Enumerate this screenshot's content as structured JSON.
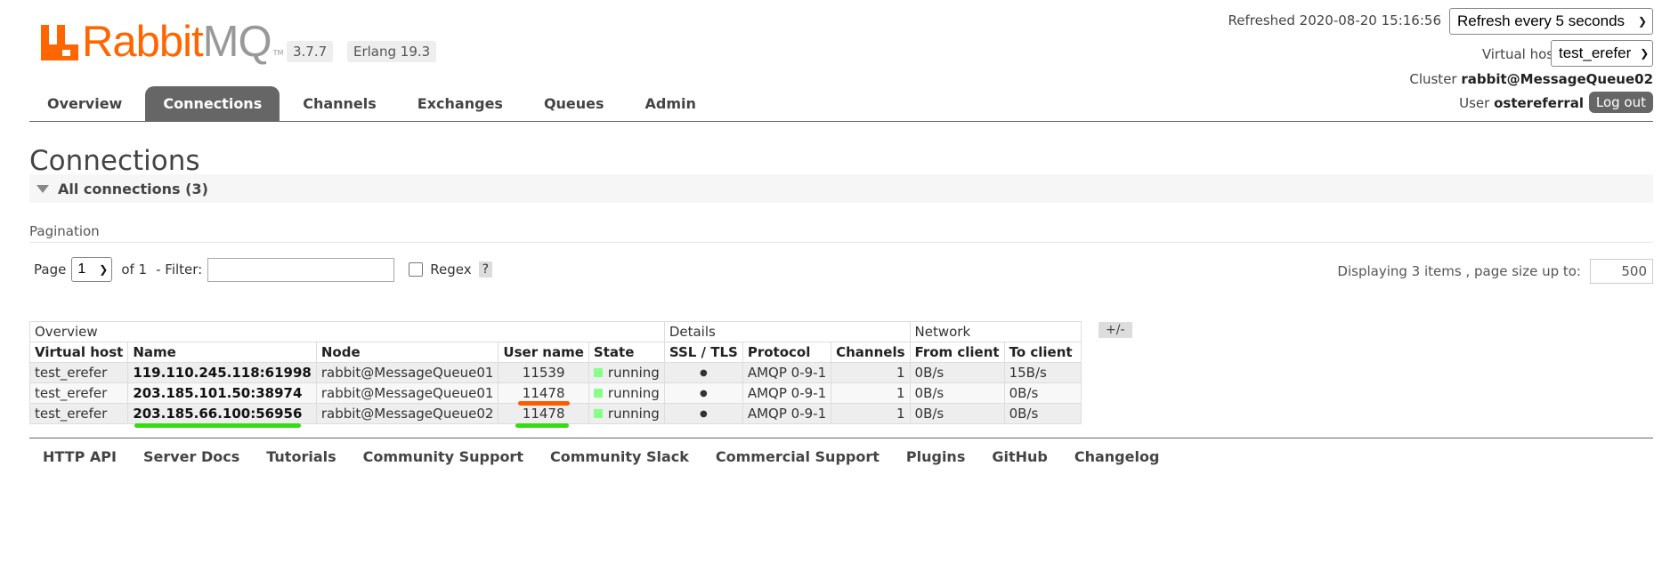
{
  "header": {
    "logo_text_rabbit": "Rabbit",
    "logo_text_mq": "MQ",
    "logo_tm": "TM",
    "version": "3.7.7",
    "erlang": "Erlang 19.3",
    "refreshed": "Refreshed 2020-08-20 15:16:56",
    "refresh_select": "Refresh every 5 seconds",
    "vhost_label": "Virtual host",
    "vhost_select": "test_erefer",
    "cluster_label": "Cluster",
    "cluster_name": "rabbit@MessageQueue02",
    "user_label": "User",
    "user_name": "ostereferral",
    "logout": "Log out"
  },
  "tabs": [
    {
      "label": "Overview"
    },
    {
      "label": "Connections"
    },
    {
      "label": "Channels"
    },
    {
      "label": "Exchanges"
    },
    {
      "label": "Queues"
    },
    {
      "label": "Admin"
    }
  ],
  "page_title": "Connections",
  "section_title": "All connections (3)",
  "pagination": {
    "heading": "Pagination",
    "page_label": "Page",
    "page_value": "1",
    "of_label": "of 1",
    "filter_label": "- Filter:",
    "filter_value": "",
    "regex_label": "Regex",
    "help": "?",
    "display_text": "Displaying 3 items , page size up to:",
    "page_size": "500"
  },
  "table": {
    "groups": [
      "Overview",
      "Details",
      "Network"
    ],
    "columns": [
      "Virtual host",
      "Name",
      "Node",
      "User name",
      "State",
      "SSL / TLS",
      "Protocol",
      "Channels",
      "From client",
      "To client"
    ],
    "rows": [
      {
        "vhost": "test_erefer",
        "name": "119.110.245.118:61998",
        "node": "rabbit@MessageQueue01",
        "user": "11539",
        "state": "running",
        "ssl": "●",
        "protocol": "AMQP 0-9-1",
        "channels": "1",
        "from_client": "0B/s",
        "to_client": "15B/s"
      },
      {
        "vhost": "test_erefer",
        "name": "203.185.101.50:38974",
        "node": "rabbit@MessageQueue01",
        "user": "11478",
        "state": "running",
        "ssl": "●",
        "protocol": "AMQP 0-9-1",
        "channels": "1",
        "from_client": "0B/s",
        "to_client": "0B/s"
      },
      {
        "vhost": "test_erefer",
        "name": "203.185.66.100:56956",
        "node": "rabbit@MessageQueue02",
        "user": "11478",
        "state": "running",
        "ssl": "●",
        "protocol": "AMQP 0-9-1",
        "channels": "1",
        "from_client": "0B/s",
        "to_client": "0B/s"
      }
    ],
    "plusminus": "+/-"
  },
  "annotation_colors": {
    "orange": "#ff5a00",
    "green": "#33dd11"
  },
  "footer": [
    "HTTP API",
    "Server Docs",
    "Tutorials",
    "Community Support",
    "Community Slack",
    "Commercial Support",
    "Plugins",
    "GitHub",
    "Changelog"
  ],
  "colors": {
    "brand": "#ff6600",
    "tab_active": "#666666",
    "state_running": "#88ff88"
  }
}
